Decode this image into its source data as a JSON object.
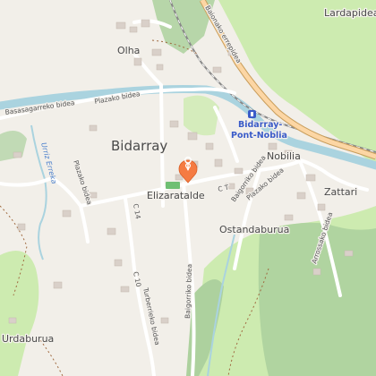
{
  "labels": {
    "olha": "Olha",
    "bidarray": "Bidarray",
    "elizaratalde": "Elizaratalde",
    "lardapidea": "Lardapidea",
    "nobilia": "Nobilia",
    "zattari": "Zattari",
    "ostandaburua": "Ostandaburua",
    "urdaburua": "Urdaburua",
    "station_line1": "Bidarray-",
    "station_line2": "Pont-Noblia",
    "bayonne_road": "Baionako errepidea",
    "basasagarreko": "Basasagarreko bidea",
    "plazako_1": "Plazako bidea",
    "plazako_2": "Plazako bidea",
    "plazako_3": "Plazako bidea",
    "ct_label": "C T",
    "c14": "C 14",
    "c10": "C 10",
    "turberrieko": "Turberrieko bidea",
    "baigorriko_1": "Baigorriko bidea",
    "baigorriko_2": "Baigorriko bidea",
    "arrossako": "Arrossako bidea",
    "urriz_river": "Urriz Erreka"
  },
  "colors": {
    "background": "#f2efe9",
    "forest": "#add19e",
    "meadow": "#cdebb0",
    "water": "#aad3df",
    "primary_road": "#fcd6a4",
    "primary_road_casing": "#c99e5c",
    "marker": "#f57b42",
    "station": "#3a5bc8"
  },
  "marker": {
    "icon": "map-pin-icon"
  }
}
